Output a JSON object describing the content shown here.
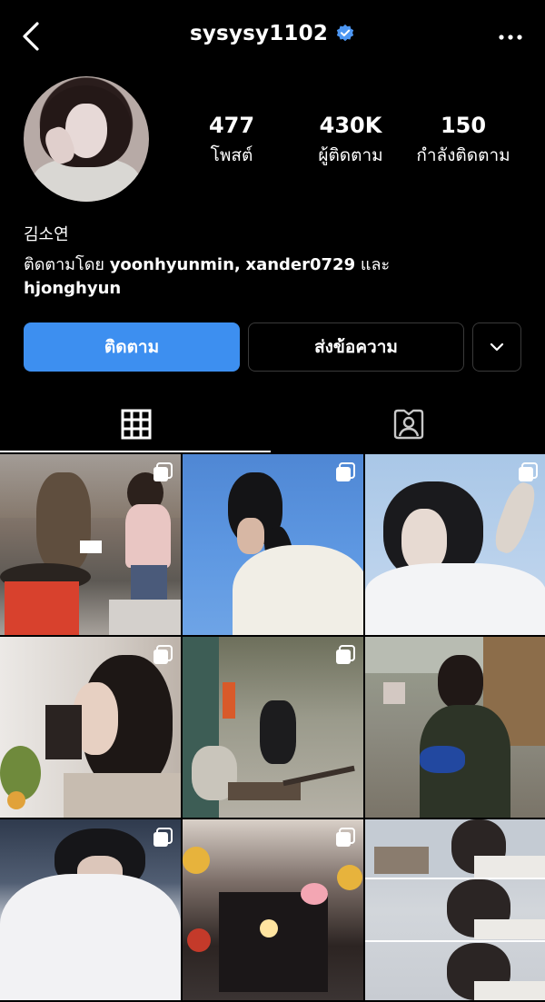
{
  "header": {
    "username": "sysysy1102",
    "verified": true
  },
  "profile": {
    "full_name": "김소연",
    "followed_by_prefix": "ติดตามโดย",
    "followed_by_users": [
      "yoonhyunmin",
      "xander0729"
    ],
    "followed_by_and": "และ",
    "followed_by_last": "hjonghyun"
  },
  "stats": {
    "posts": {
      "value": "477",
      "label": "โพสต์"
    },
    "followers": {
      "value": "430K",
      "label": "ผู้ติดตาม"
    },
    "following": {
      "value": "150",
      "label": "กำลังติดตาม"
    }
  },
  "actions": {
    "follow_label": "ติดตาม",
    "message_label": "ส่งข้อความ"
  },
  "tabs": [
    {
      "icon": "grid-icon",
      "active": true
    },
    {
      "icon": "tagged-person-icon",
      "active": false
    }
  ],
  "colors": {
    "background": "#000000",
    "accent": "#3d8ff0",
    "verified": "#4d97f3"
  },
  "posts": [
    {
      "multi": true
    },
    {
      "multi": true
    },
    {
      "multi": true
    },
    {
      "multi": true
    },
    {
      "multi": true
    },
    {
      "multi": false
    },
    {
      "multi": true
    },
    {
      "multi": true
    },
    {
      "multi": false
    }
  ]
}
